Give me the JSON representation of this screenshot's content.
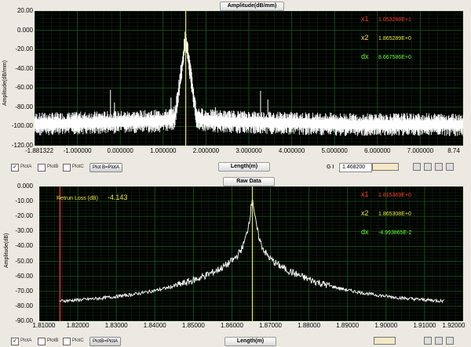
{
  "top": {
    "title": "Amplitude(dB/mm)",
    "ylabel": "Amplitude(dB/mm)",
    "xlabel": "Length(m)",
    "yticks": [
      "20.00",
      "0.000",
      "-20.00",
      "-40.00",
      "-60.00",
      "-80.00",
      "-100.00",
      "-120.00"
    ],
    "xticks": [
      "-1.881322",
      "-1.000000",
      "0.000000",
      "1.000000",
      "2.000000",
      "3.000000",
      "4.000000",
      "5.000000",
      "6.000000",
      "7.000000",
      "8.74"
    ],
    "cursors": [
      {
        "name": "x1",
        "value": "1.053288E+1",
        "color": "#ff3b2f"
      },
      {
        "name": "x2",
        "value": "1.865289E+0",
        "color": "#f2e84a"
      },
      {
        "name": "dx",
        "value": "8.667586E+0",
        "color": "#66ff33"
      }
    ],
    "plots": [
      "PlotA",
      "PlotB",
      "PlotC"
    ],
    "plot_button": "Plot B=PlotA",
    "gain_label": "G I",
    "gain_value": "1.468200",
    "colors": {
      "grid": "#1f5a1f",
      "trace": "#ffffff",
      "cursor": "#f2e84a"
    }
  },
  "bottom": {
    "title": "Raw Data",
    "ylabel": "Amplitude(dB)",
    "xlabel": "Length(m)",
    "yticks": [
      "0.000",
      "-10.00",
      "-20.00",
      "-30.00",
      "-40.00",
      "-50.00",
      "-60.00",
      "-70.00",
      "-80.00",
      "-90.00"
    ],
    "xticks": [
      "1.81000",
      "1.82000",
      "1.83000",
      "1.84000",
      "1.85000",
      "1.86000",
      "1.87000",
      "1.88000",
      "1.89000",
      "1.90000",
      "1.91000",
      "1.92000"
    ],
    "annotation_label": "Retrun Loss  (dB)",
    "annotation_value": "-4.143",
    "cursors": [
      {
        "name": "x1",
        "value": "1.815369E+0",
        "color": "#ff3b2f"
      },
      {
        "name": "x2",
        "value": "1.865308E+0",
        "color": "#f2e84a"
      },
      {
        "name": "dx",
        "value": "-4.993865E-2",
        "color": "#66ff33"
      }
    ],
    "plots": [
      "PlotA",
      "PlotB",
      "PlotC"
    ],
    "plot_button": "PlotB=PlotA"
  }
}
